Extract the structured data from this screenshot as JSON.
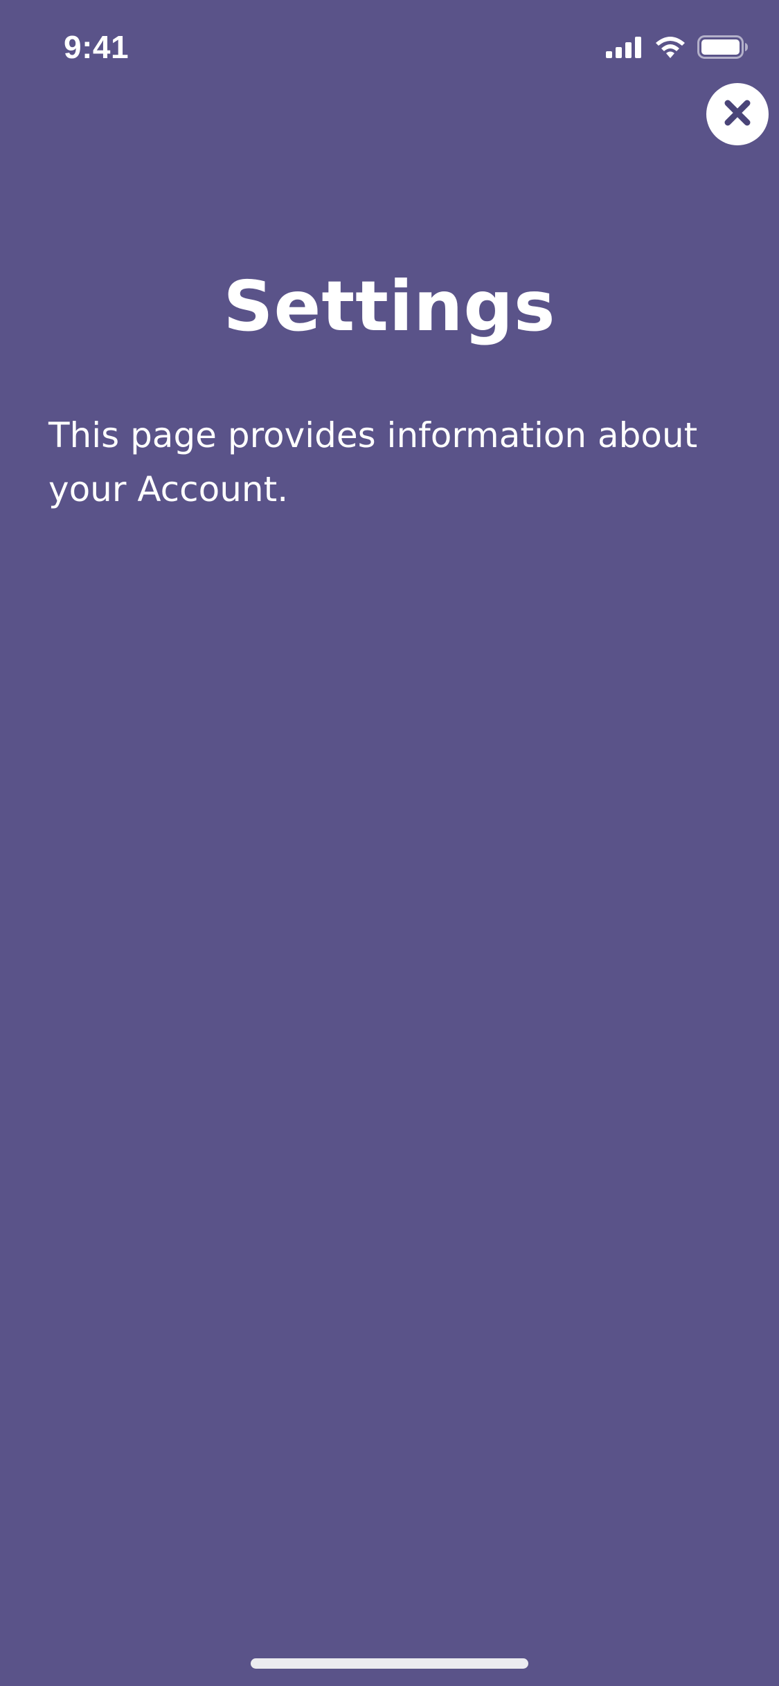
{
  "status_bar": {
    "time": "9:41",
    "icons": [
      "cellular-signal-icon",
      "wifi-icon",
      "battery-icon"
    ]
  },
  "close_button": {
    "icon": "close-icon"
  },
  "page": {
    "title": "Settings",
    "description": "This page provides information about your Account."
  },
  "colors": {
    "background": "#5a5389",
    "text": "#ffffff",
    "close_button_bg": "#ffffff",
    "close_icon": "#4a4478",
    "home_indicator": "#ebebf0"
  }
}
